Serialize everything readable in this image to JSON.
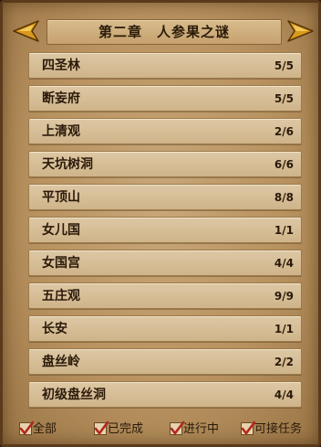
{
  "header": {
    "title": "第二章　人参果之谜",
    "prev_icon": "left-arrow-icon",
    "next_icon": "right-arrow-icon",
    "arrow_color": "#d89a1c"
  },
  "quests": [
    {
      "name": "四圣林",
      "progress": "5/5"
    },
    {
      "name": "断妄府",
      "progress": "5/5"
    },
    {
      "name": "上清观",
      "progress": "2/6"
    },
    {
      "name": "天坑树洞",
      "progress": "6/6"
    },
    {
      "name": "平顶山",
      "progress": "8/8"
    },
    {
      "name": "女儿国",
      "progress": "1/1"
    },
    {
      "name": "女国宫",
      "progress": "4/4"
    },
    {
      "name": "五庄观",
      "progress": "9/9"
    },
    {
      "name": "长安",
      "progress": "1/1"
    },
    {
      "name": "盘丝岭",
      "progress": "2/2"
    },
    {
      "name": "初级盘丝洞",
      "progress": "4/4"
    }
  ],
  "filters": [
    {
      "label": "全部",
      "checked": true
    },
    {
      "label": "已完成",
      "checked": true
    },
    {
      "label": "进行中",
      "checked": true
    },
    {
      "label": "可接任务",
      "checked": true
    }
  ],
  "colors": {
    "check_mark": "#b3261e",
    "panel_border": "#5a3a1a"
  }
}
